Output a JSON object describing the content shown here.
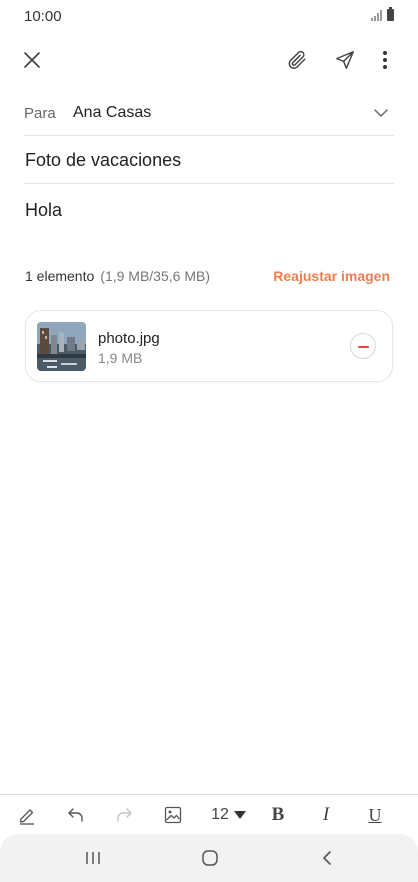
{
  "status_bar": {
    "time": "10:00"
  },
  "toolbar": {
    "close_icon": "close-icon",
    "attach_icon": "paperclip-icon",
    "send_icon": "send-icon",
    "more_icon": "more-vertical-icon"
  },
  "compose": {
    "to_label": "Para",
    "to_value": "Ana Casas",
    "subject": "Foto de vacaciones",
    "body": "Hola"
  },
  "attachments": {
    "summary": "1 elemento",
    "size_summary": "(1,9 MB/35,6 MB)",
    "resize_label": "Reajustar imagen",
    "accent_color": "#ef7d4e",
    "items": [
      {
        "name": "photo.jpg",
        "size": "1,9 MB"
      }
    ]
  },
  "format_bar": {
    "font_size": "12",
    "bold_label": "B",
    "italic_label": "I",
    "underline_label": "U"
  }
}
